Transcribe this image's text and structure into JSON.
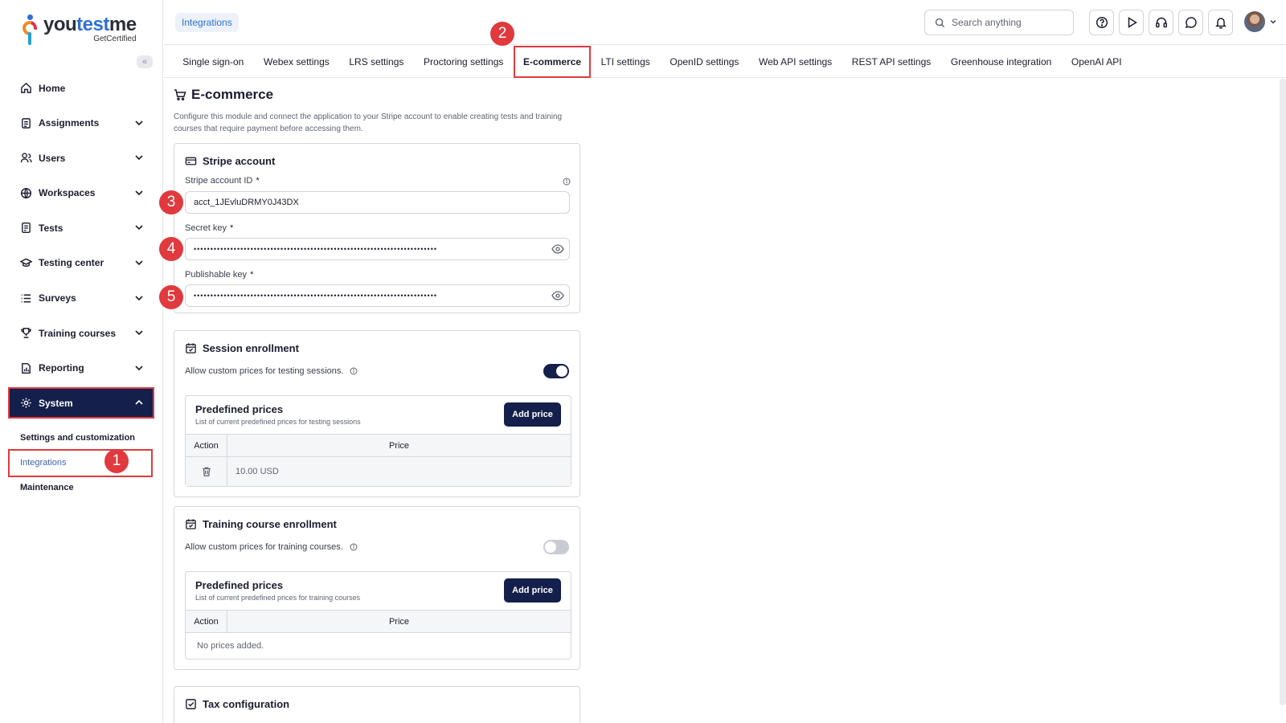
{
  "brand": {
    "name_part1": "you",
    "name_part2": "test",
    "name_part3": "me",
    "tagline": "GetCertified"
  },
  "sidebar": {
    "collapse_glyph": "«",
    "items": [
      {
        "label": "Home",
        "icon": "home-icon"
      },
      {
        "label": "Assignments",
        "icon": "clipboard-icon"
      },
      {
        "label": "Users",
        "icon": "users-icon"
      },
      {
        "label": "Workspaces",
        "icon": "globe-icon"
      },
      {
        "label": "Tests",
        "icon": "test-icon"
      },
      {
        "label": "Testing center",
        "icon": "graduation-cap-icon"
      },
      {
        "label": "Surveys",
        "icon": "list-icon"
      },
      {
        "label": "Training courses",
        "icon": "trophy-icon"
      },
      {
        "label": "Reporting",
        "icon": "report-icon"
      },
      {
        "label": "System",
        "icon": "gear-icon"
      }
    ],
    "sub_items": [
      "Settings and customization",
      "Integrations",
      "Maintenance"
    ]
  },
  "topbar": {
    "breadcrumb": "Integrations",
    "search_placeholder": "Search anything"
  },
  "tabs": [
    "Single sign-on",
    "Webex settings",
    "LRS settings",
    "Proctoring settings",
    "E-commerce",
    "LTI settings",
    "OpenID settings",
    "Web API settings",
    "REST API settings",
    "Greenhouse integration",
    "OpenAI API"
  ],
  "page": {
    "title": "E-commerce",
    "description": "Configure this module and connect the application to your Stripe account to enable creating tests and training courses that require payment before accessing them."
  },
  "stripe": {
    "title": "Stripe account",
    "account_id_label": "Stripe account ID",
    "account_id_value": "acct_1JEvluDRMY0J43DX",
    "secret_key_label": "Secret key",
    "secret_key_value": "•••••••••••••••••••••••••••••••••••••••••••••••••••••••••••••••••••••••••",
    "publishable_key_label": "Publishable key",
    "publishable_key_value": "•••••••••••••••••••••••••••••••••••••••••••••••••••••••••••••••••••••••••",
    "required_mark": "*"
  },
  "session_enrollment": {
    "title": "Session enrollment",
    "toggle_label": "Allow custom prices for testing sessions.",
    "toggle_on": true,
    "prices_title": "Predefined prices",
    "prices_subtitle": "List of current predefined prices for testing sessions",
    "add_button": "Add price",
    "col_action": "Action",
    "col_price": "Price",
    "rows": [
      "10.00 USD"
    ]
  },
  "training_enrollment": {
    "title": "Training course enrollment",
    "toggle_label": "Allow custom prices for training courses.",
    "toggle_on": false,
    "prices_title": "Predefined prices",
    "prices_subtitle": "List of current predefined prices for training courses",
    "add_button": "Add price",
    "col_action": "Action",
    "col_price": "Price",
    "empty_text": "No prices added."
  },
  "tax": {
    "title": "Tax configuration"
  },
  "annotations": [
    "1",
    "2",
    "3",
    "4",
    "5"
  ],
  "colors": {
    "navy": "#14204b",
    "highlight_red": "#e0393e",
    "link_blue": "#2f6fd6"
  }
}
